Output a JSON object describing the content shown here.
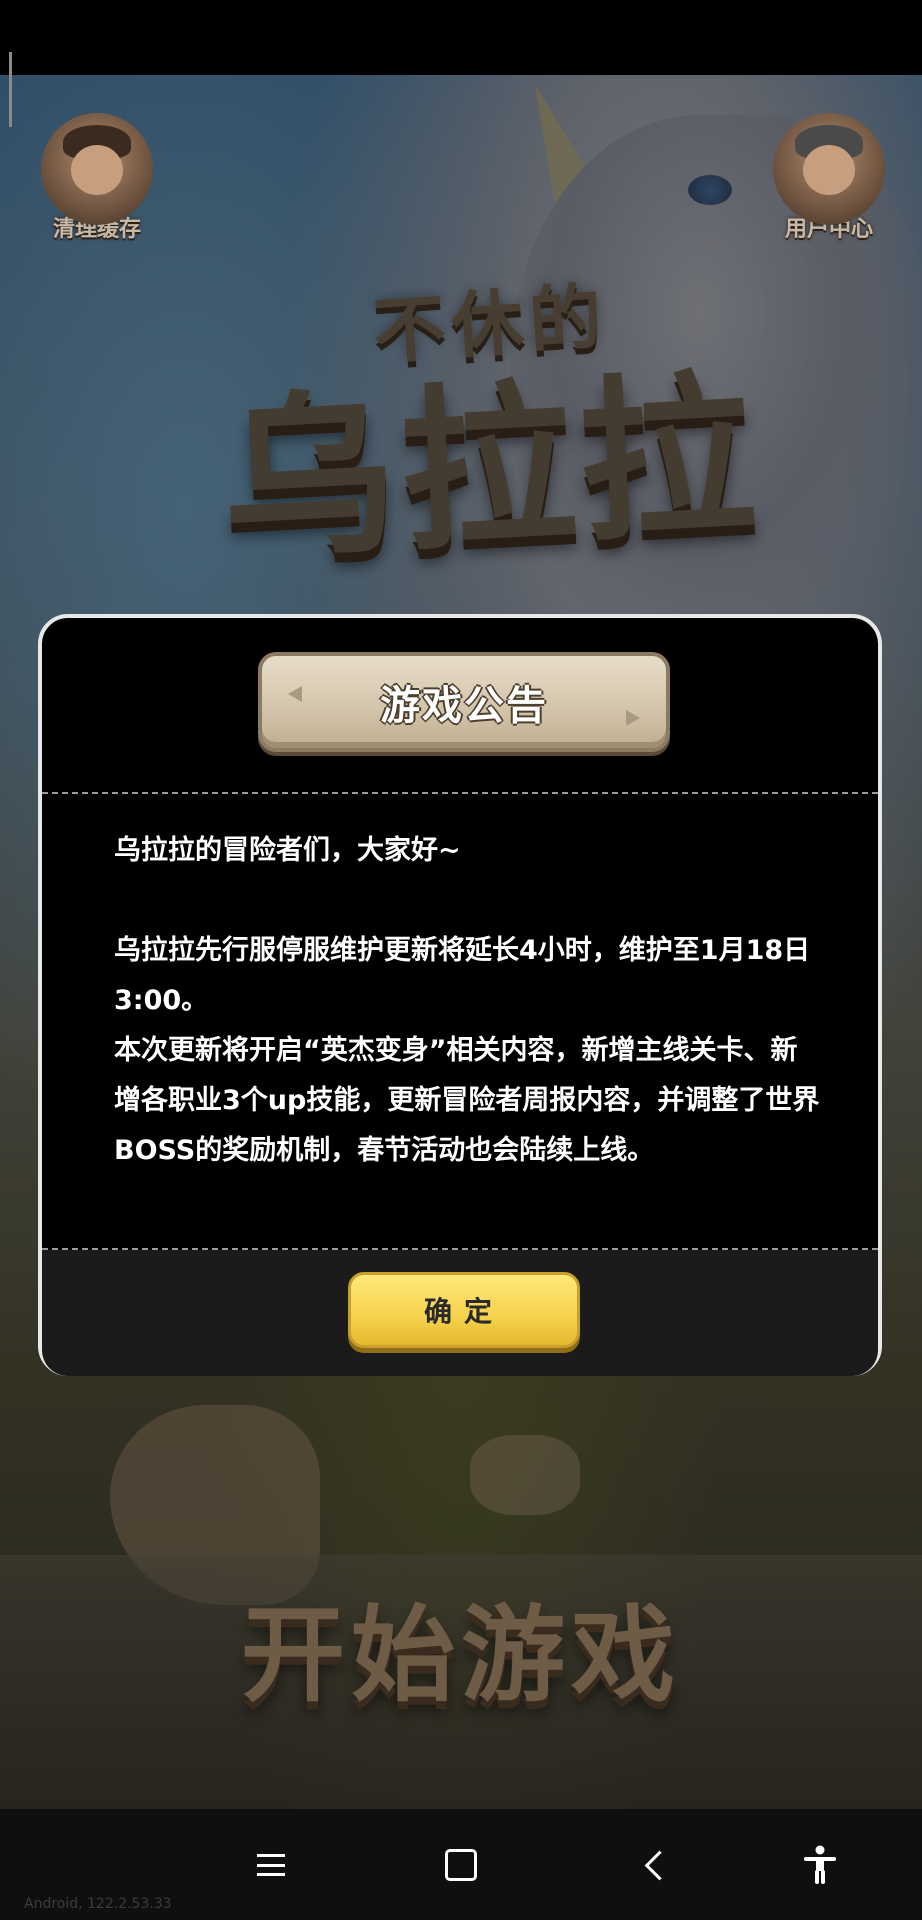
{
  "corner_buttons": {
    "clear_cache": "清理缓存",
    "user_center": "用户中心"
  },
  "logo": {
    "line1": "不休的",
    "line2": "乌拉拉"
  },
  "start_game": "开始游戏",
  "notice": {
    "title": "游戏公告",
    "greeting": "乌拉拉的冒险者们，大家好~",
    "paragraph1": "乌拉拉先行服停服维护更新将延长4小时，维护至1月18日3:00。",
    "paragraph2": "本次更新将开启“英杰变身”相关内容，新增主线关卡、新增各职业3个up技能，更新冒险者周报内容，并调整了世界BOSS的奖励机制，春节活动也会陆续上线。",
    "confirm_label": "确定"
  },
  "build_info": "Android, 122.2.53.33",
  "colors": {
    "confirm_button": "#f6d24c",
    "modal_border": "#e8e8e8",
    "modal_background": "#000000"
  },
  "icons": {
    "nav_menu": "menu-icon",
    "nav_home": "home-square-icon",
    "nav_back": "back-chevron-icon",
    "nav_accessibility": "accessibility-icon"
  }
}
